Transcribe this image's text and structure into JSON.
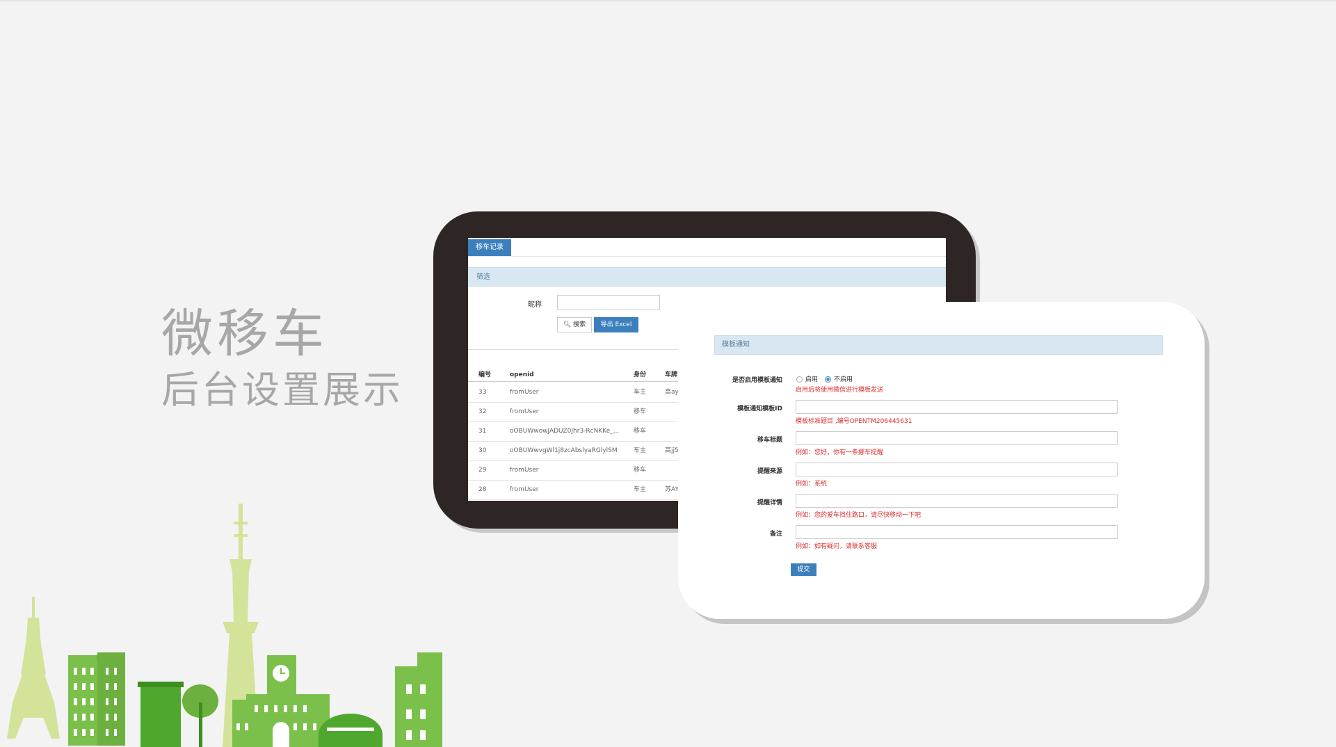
{
  "headline": {
    "title": "微移车",
    "subtitle": "后台设置展示"
  },
  "record_screen": {
    "tab_label": "移车记录",
    "filter_panel_title": "筛选",
    "nickname_label": "昵称",
    "search_label": "搜索",
    "export_label": "导出 Excel",
    "columns": [
      "编号",
      "openid",
      "身份",
      "车牌"
    ],
    "rows": [
      [
        "33",
        "fromUser",
        "车主",
        "高ay"
      ],
      [
        "32",
        "fromUser",
        "移车",
        ""
      ],
      [
        "31",
        "oOBUWwowJADUZ0Jhr3-RcNKKe_...",
        "移车",
        ""
      ],
      [
        "30",
        "oOBUWwvgWl1j8zcAbslyaRGlylSM",
        "车主",
        "高jj5"
      ],
      [
        "29",
        "fromUser",
        "移车",
        ""
      ],
      [
        "28",
        "fromUser",
        "车主",
        "苏AY"
      ]
    ]
  },
  "template_screen": {
    "panel_title": "模板通知",
    "enable_label": "是否启用模板通知",
    "radio_on_label": "启用",
    "radio_off_label": "不启用",
    "enable_hint": "启用后将使用微信进行模板发送",
    "template_id_label": "模板通知模板ID",
    "template_id_hint": "模板标准题目 ,编号OPENTM206445631",
    "title_label": "移车标题",
    "title_hint": "例如：您好，你有一条挪车提醒",
    "source_label": "提醒来源",
    "source_hint": "例如：系统",
    "detail_label": "提醒详情",
    "detail_hint": "例如：您的爱车挡住路口，请尽快移动一下吧",
    "remark_label": "备注",
    "remark_hint": "例如：如有疑问，请联系客服",
    "submit_label": "提交"
  }
}
